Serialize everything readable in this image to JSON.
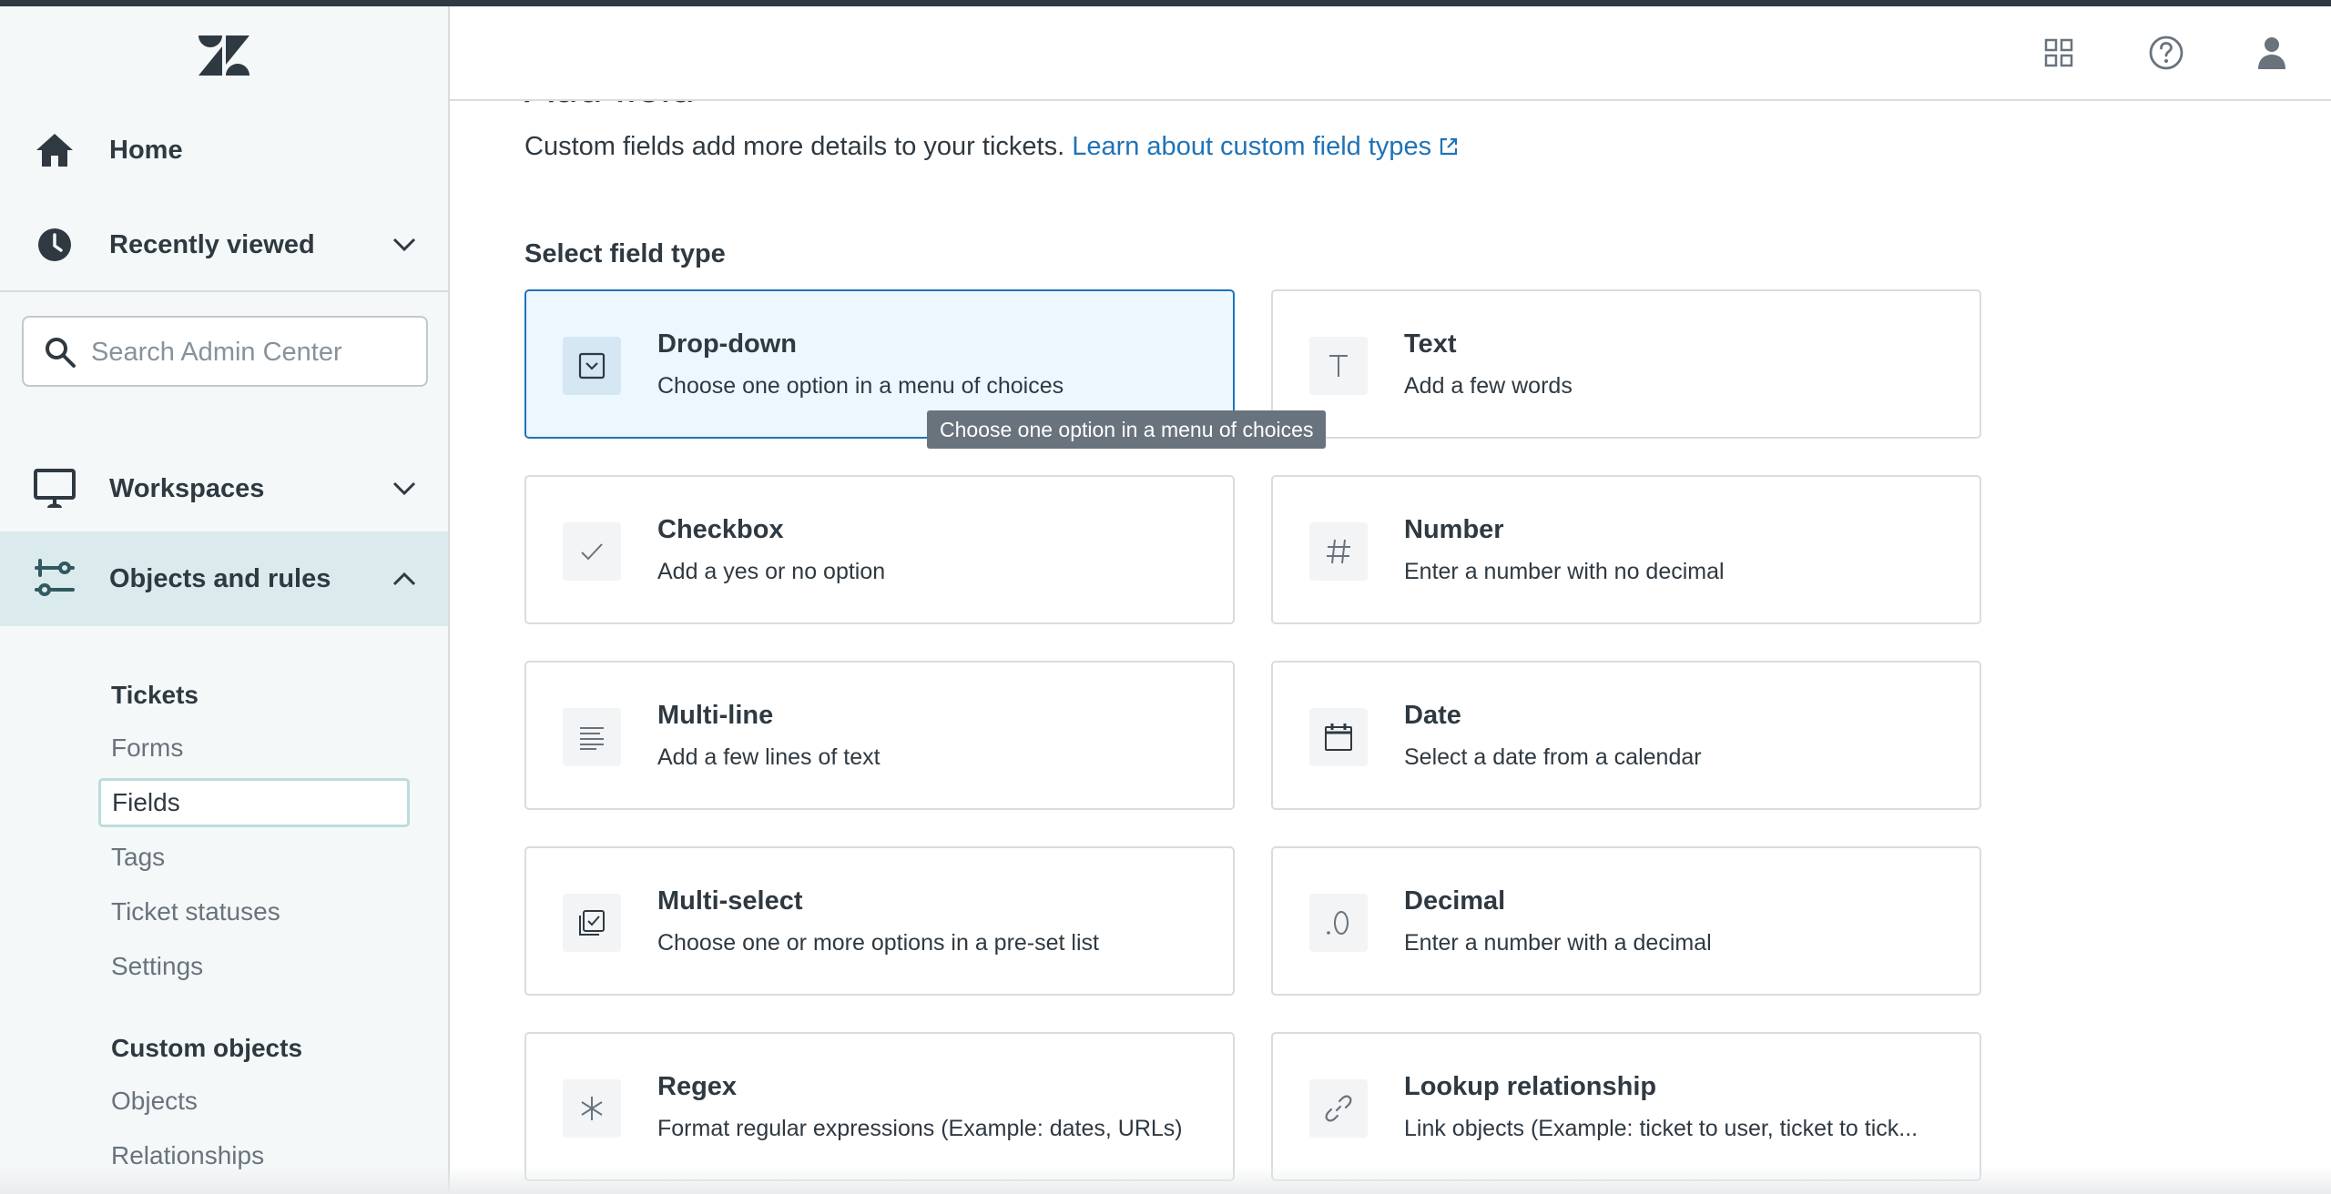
{
  "sidebar": {
    "nav": {
      "home": "Home",
      "recently_viewed": "Recently viewed",
      "workspaces": "Workspaces",
      "objects_and_rules": "Objects and rules"
    },
    "search": {
      "placeholder": "Search Admin Center"
    },
    "sections": [
      {
        "heading": "Tickets",
        "items": [
          "Forms",
          "Fields",
          "Tags",
          "Ticket statuses",
          "Settings"
        ],
        "selected": "Fields"
      },
      {
        "heading": "Custom objects",
        "items": [
          "Objects",
          "Relationships"
        ]
      }
    ]
  },
  "header": {
    "icons": [
      "apps-grid-icon",
      "help-icon",
      "user-profile-icon"
    ]
  },
  "main": {
    "title": "Add field",
    "description": "Custom fields add more details to your tickets.",
    "learn_link": "Learn about custom field types",
    "section_label": "Select field type",
    "field_types": [
      {
        "title": "Drop-down",
        "desc": "Choose one option in a menu of choices",
        "icon": "dropdown-icon",
        "selected": true
      },
      {
        "title": "Text",
        "desc": "Add a few words",
        "icon": "text-icon"
      },
      {
        "title": "Checkbox",
        "desc": "Add a yes or no option",
        "icon": "checkmark-icon"
      },
      {
        "title": "Number",
        "desc": "Enter a number with no decimal",
        "icon": "hash-icon"
      },
      {
        "title": "Multi-line",
        "desc": "Add a few lines of text",
        "icon": "lines-icon"
      },
      {
        "title": "Date",
        "desc": "Select a date from a calendar",
        "icon": "calendar-icon"
      },
      {
        "title": "Multi-select",
        "desc": "Choose one or more options in a pre-set list",
        "icon": "multiselect-icon"
      },
      {
        "title": "Decimal",
        "desc": "Enter a number with a decimal",
        "icon": "decimal-icon"
      },
      {
        "title": "Regex",
        "desc": "Format regular expressions (Example: dates, URLs)",
        "icon": "asterisk-icon"
      },
      {
        "title": "Lookup relationship",
        "desc": "Link objects (Example: ticket to user, ticket to tick...",
        "icon": "link-icon"
      }
    ],
    "tooltip": "Choose one option in a menu of choices"
  },
  "colors": {
    "brand_blue": "#1f73b7",
    "active_nav": "#dbeaec",
    "sidebar_bg": "#f5f8f8",
    "text": "#2f3941"
  }
}
